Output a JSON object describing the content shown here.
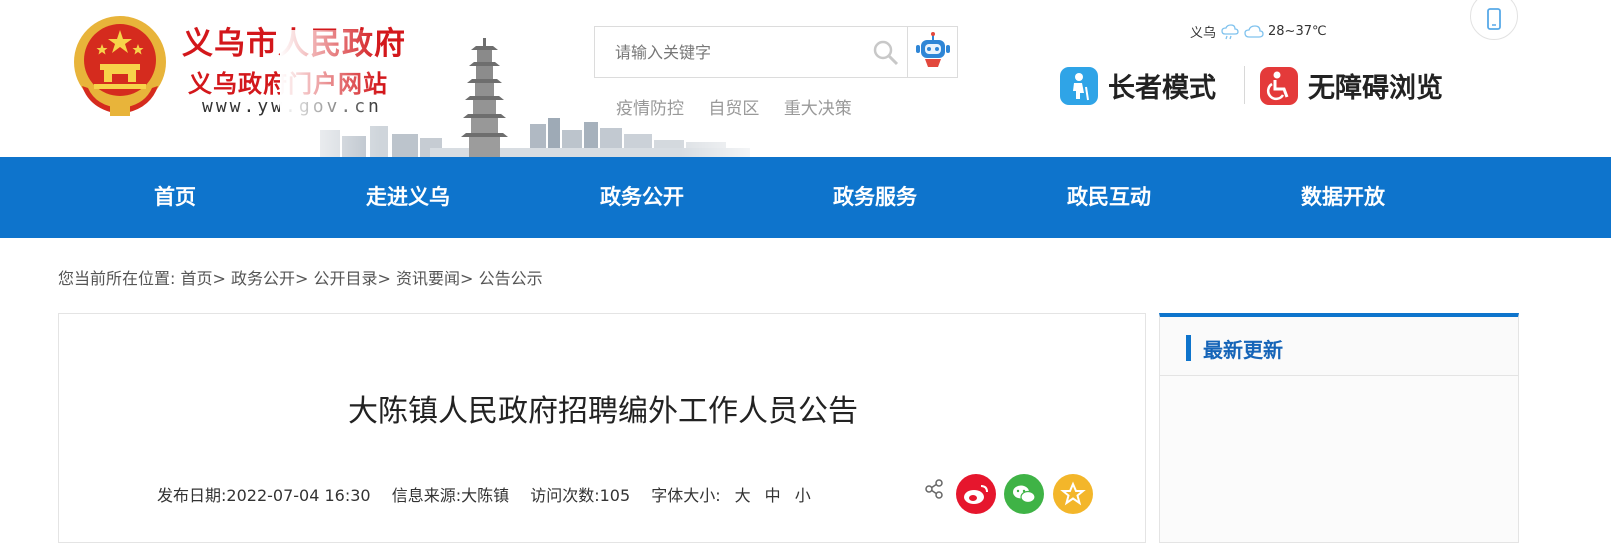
{
  "header": {
    "site_title": "义乌市人民政府",
    "site_subtitle": "义乌政府门户网站",
    "site_url": "www.yw.gov.cn",
    "search_placeholder": "请输入关键字",
    "hot_links": [
      "疫情防控",
      "自贸区",
      "重大决策"
    ],
    "weather": {
      "city": "义乌",
      "temp": "28~37℃"
    },
    "elder_mode": "长者模式",
    "accessible_mode": "无障碍浏览"
  },
  "nav": {
    "items": [
      "首页",
      "走进义乌",
      "政务公开",
      "政务服务",
      "政民互动",
      "数据开放"
    ]
  },
  "breadcrumb": {
    "prefix": "您当前所在位置:",
    "items": [
      "首页>",
      "政务公开>",
      "公开目录>",
      "资讯要闻>",
      "公告公示"
    ]
  },
  "article": {
    "title": "大陈镇人民政府招聘编外工作人员公告",
    "date_label": "发布日期:",
    "date": "2022-07-04 16:30",
    "source_label": "信息来源:",
    "source": "大陈镇",
    "views_label": "访问次数:",
    "views": "105",
    "font_label": "字体大小:",
    "font_sizes": [
      "大",
      "中",
      "小"
    ]
  },
  "sidebar": {
    "title": "最新更新"
  },
  "colors": {
    "brand_blue": "#0e74cc",
    "title_red": "#d3171b"
  }
}
